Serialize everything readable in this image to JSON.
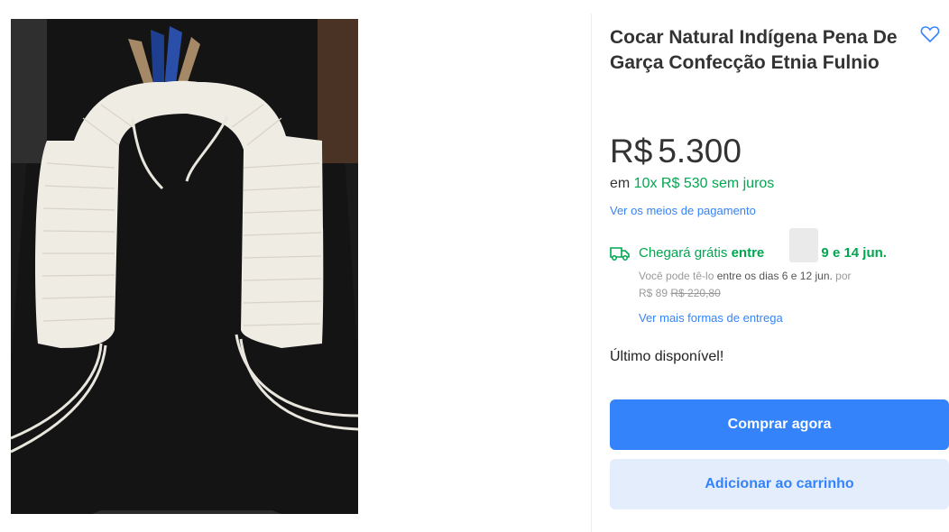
{
  "product": {
    "title": "Cocar Natural Indígena Pena De Garça Confecção Etnia Fulnio",
    "image_icon": "feather-headdress-photo",
    "favorite_icon": "heart-outline-icon"
  },
  "price": {
    "currency": "R$",
    "amount": "5.300",
    "installments_prefix": "em ",
    "installments_value": "10x R$ 530 sem juros",
    "payment_link": "Ver os meios de pagamento"
  },
  "shipping": {
    "icon": "truck-icon",
    "free_prefix": "Chegará grátis ",
    "free_word": "entre",
    "free_dates": "dias 9 e 14 jun.",
    "alt_prefix": "Você pode tê-lo ",
    "alt_dates": "entre os dias 6 e 12 jun.",
    "alt_suffix": " por",
    "alt_price": "R$ 89",
    "alt_old_price": "R$ 220,80",
    "more_link": "Ver mais formas de entrega"
  },
  "stock": {
    "label": "Último disponível!"
  },
  "actions": {
    "buy_label": "Comprar agora",
    "cart_label": "Adicionar ao carrinho"
  },
  "colors": {
    "primary": "#3483fa",
    "green": "#00a650",
    "secondary_button_bg": "#e3edfb"
  }
}
